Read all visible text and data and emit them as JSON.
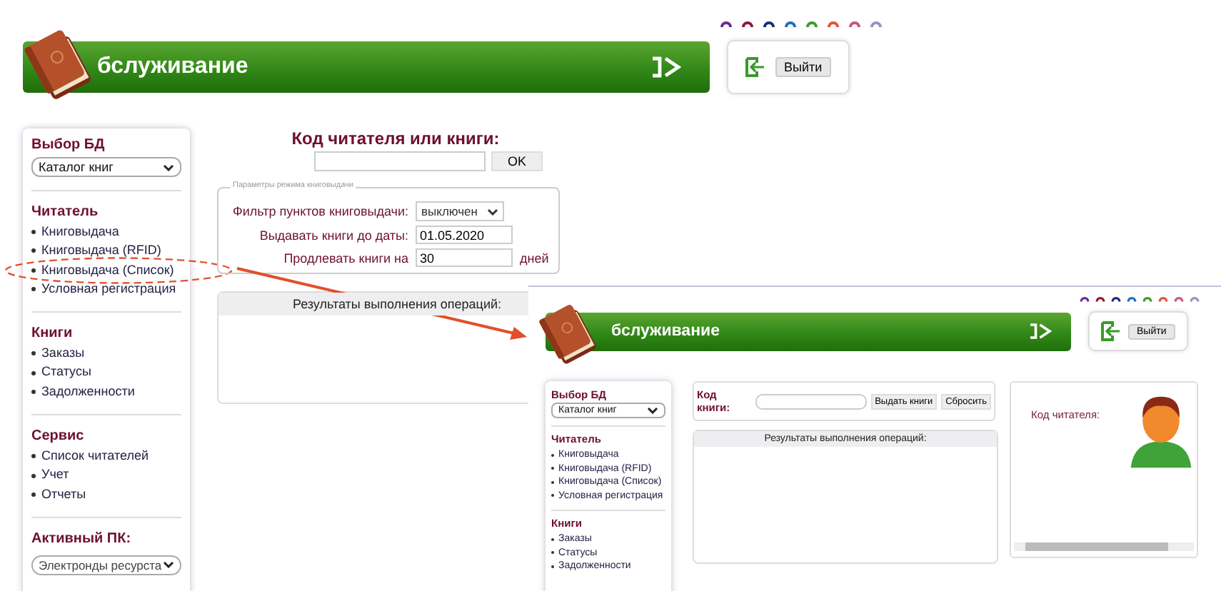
{
  "theme_dots": [
    {
      "color": "#6a2c91"
    },
    {
      "color": "#8b1a3a"
    },
    {
      "color": "#1f2a7a"
    },
    {
      "color": "#1e6fc0"
    },
    {
      "color": "#3c9a2e"
    },
    {
      "color": "#e0533a"
    },
    {
      "color": "#c4577a"
    },
    {
      "color": "#9b8fc4"
    }
  ],
  "main_screen": {
    "header": {
      "title": "бслуживание",
      "logout": "Выйти"
    },
    "sidebar": {
      "db_label": "Выбор БД",
      "db_select": "Каталог книг",
      "sections": [
        {
          "title": "Читатель",
          "items": [
            {
              "label": "Книговыдача",
              "circled": false
            },
            {
              "label": "Книговыдача (RFID)",
              "circled": false
            },
            {
              "label": "Книговыдача (Список)",
              "circled": true
            },
            {
              "label": "Условная регистрация",
              "circled": false
            }
          ]
        },
        {
          "title": "Книги",
          "items": [
            {
              "label": "Заказы",
              "circled": false
            },
            {
              "label": "Статусы",
              "circled": false
            },
            {
              "label": "Задолженности",
              "circled": false
            }
          ]
        },
        {
          "title": "Сервис",
          "items": [
            {
              "label": "Список читателей",
              "circled": false
            },
            {
              "label": "Учет",
              "circled": false
            },
            {
              "label": "Отчеты",
              "circled": false
            }
          ]
        }
      ],
      "active_pc_label": "Активный ПК:",
      "active_pc_select": "Электронды ресурста"
    },
    "code_label": "Код читателя или книги:",
    "ok_button": "OK",
    "params": {
      "legend": "Параметры режима книговыдачи",
      "filter_label": "Фильтр пунктов книговыдачи:",
      "filter_value": "выключен",
      "date_label": "Выдавать книги до даты:",
      "date_value": "01.05.2020",
      "extend_label": "Продлевать книги на",
      "extend_value": "30",
      "extend_unit": "дней"
    },
    "results_title": "Результаты выполнения операций:"
  },
  "inset_screen": {
    "header": {
      "title": "бслуживание",
      "logout": "Выйти"
    },
    "sidebar": {
      "db_label": "Выбор БД",
      "db_select": "Каталог книг",
      "sections": [
        {
          "title": "Читатель",
          "items": [
            {
              "label": "Книговыдача"
            },
            {
              "label": "Книговыдача (RFID)"
            },
            {
              "label": "Книговыдача (Список)"
            },
            {
              "label": "Условная регистрация"
            }
          ]
        },
        {
          "title": "Книги",
          "items": [
            {
              "label": "Заказы"
            },
            {
              "label": "Статусы"
            },
            {
              "label": "Задолженности"
            }
          ]
        }
      ]
    },
    "book_code_label": "Код книги:",
    "issue_button": "Выдать книги",
    "reset_button": "Сбросить",
    "results_title": "Результаты выполнения операций:",
    "reader_code_label": "Код читателя:"
  }
}
